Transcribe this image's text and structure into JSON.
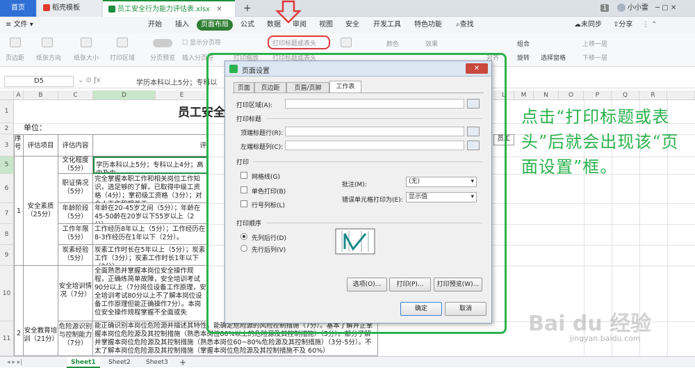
{
  "tabs": {
    "home": "首页",
    "template": "稻壳模板",
    "file": "员工安全行为能力评估表.xlsx",
    "badge": "1",
    "user": "小小雷"
  },
  "menu": {
    "file": "文件",
    "items": [
      "开始",
      "插入",
      "页面布局",
      "公式",
      "数据",
      "审阅",
      "视图",
      "安全",
      "开发工具",
      "特色功能"
    ],
    "search": "查找",
    "sync": "未同步",
    "share": "分享"
  },
  "ribbon": {
    "margins": "页边距",
    "orientation": "纸张方向",
    "size": "纸张大小",
    "print_area": "打印区域",
    "page_preview": "分页预览",
    "show_break": "显示分页符",
    "insert_break": "插入分页符",
    "print_scale": "打印缩放",
    "print_titles": "打印标题或表头",
    "print_titles2": "打印标题或表头",
    "theme_color": "颜色",
    "effect": "效果",
    "combine": "组合",
    "rotate": "旋转",
    "align": "对齐",
    "select_pane": "选择窗格",
    "bring_forward": "上移一层",
    "send_backward": "下移一层"
  },
  "formula": {
    "cell_ref": "D5",
    "content": "学历本科以上5分；专科以"
  },
  "columns": [
    "A",
    "B",
    "C",
    "D",
    "E",
    "F",
    "G",
    "H",
    "I",
    "J",
    "K",
    "L",
    "M",
    "N",
    "O",
    "P",
    "Q",
    "R"
  ],
  "rows": [
    "1",
    "2",
    "3",
    "4",
    "5",
    "6",
    "7",
    "8",
    "9",
    "10",
    "11",
    "12"
  ],
  "sheet": {
    "title": "员工安全",
    "unit_label": "单位：",
    "h_seq": "序号",
    "h_item": "评估项目",
    "h_content": "评估内容",
    "h_standard": "评",
    "h_staff": "员工",
    "r1_num": "1",
    "r1_cat": "安全素质（25分）",
    "r5_sub": "文化程度（5分）",
    "r5_text": "学历本科以上5分；专科以上4分；高中及中",
    "r6_sub": "职证情况（5分）",
    "r6_text": "完全掌握本职工作和相关岗位工作知识，选足够的了解，已取得中级工资格（4分）；掌初级工资格（3分）；对个人工作和相关工",
    "r7_sub": "年龄阶段（5分）",
    "r7_text": "年龄在20-45岁之间（5分）；年龄在45-50龄在20岁以下55岁以上（2分）。",
    "r8_sub": "工作年限（5分）",
    "r8_text": "工作经历8年以上（5分）；工作经历在8-3作经历在1年以下（2分）。",
    "r9_sub": "炭素经验（5分）",
    "r9_text": "炭素工作时长在5年以上（5分）；炭素工作（3分）；炭素工作时长1年以下（2分）",
    "r10_sub": "安全培训情况（7分）",
    "r10_text": "全面熟悉并掌握本岗位安全操作规程，正确练简单故障，安全培训考试90分以上（7分岗位设备工作原理，安全培训考试80分以上不了解本岗位设备工作原理但能正确操作7分）。本岗位安全操作规程掌握不全面或失",
    "r2_num": "2",
    "r2_cat": "安全教育培训（21分）",
    "r11_sub": "危险源识别与控制能力（7分）",
    "r11_text": "能正确识别本岗位危险源并描述其特性，能确定危险源的风险控制措施（7分）。基本了解并正掌握本岗位危险源及其控制措施（熟悉本岗位80%以上的危险源及其控制措施）（5分）。部分了解并掌握本岗位危险源及其控制措施（熟悉本岗位60~80%危险源及其控制措施）（3分-5分）。不太了解本岗位危险源及其控制措施（掌握本岗位危险源及其控制措施不及 60%）"
  },
  "sheets": [
    "Sheet1",
    "Sheet2",
    "Sheet3"
  ],
  "dialog": {
    "title": "页面设置",
    "tabs": [
      "页面",
      "页边距",
      "页眉/页脚",
      "工作表"
    ],
    "print_area_label": "打印区域(A):",
    "print_titles_label": "打印标题",
    "title_rows_label": "顶端标题行(R):",
    "title_cols_label": "左端标题列(C):",
    "print_section": "打印",
    "gridlines": "网格线(G)",
    "mono": "单色打印(B)",
    "headings": "行号列标(L)",
    "comments_label": "批注(M):",
    "comments_value": "(无)",
    "errors_label": "错误单元格打印为(E):",
    "errors_value": "显示值",
    "order_section": "打印顺序",
    "down_then_over": "先列后行(D)",
    "over_then_down": "先行后列(V)",
    "options_btn": "选项(O)...",
    "print_btn": "打印(P)...",
    "preview_btn": "打印预览(W)...",
    "ok_btn": "确定",
    "cancel_btn": "取消"
  },
  "annotation": "点击“打印标题或表头”后就会出现该“页面设置”框。",
  "watermark": {
    "brand": "Bai du 经验",
    "url": "jingyan.baidu.com"
  },
  "colors": {
    "accent_green": "#2bb24c",
    "highlight_red": "#e03a3a",
    "wps_blue": "#2f6fd6"
  }
}
